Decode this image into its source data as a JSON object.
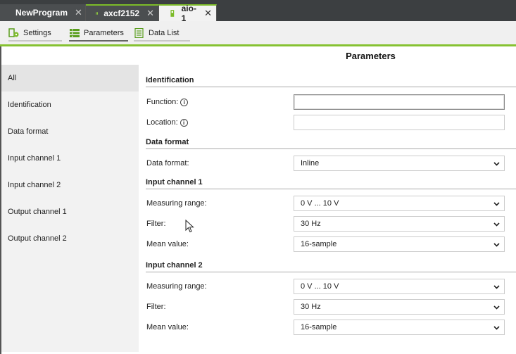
{
  "tabs": [
    {
      "label": "NewProgram",
      "icon": "program-icon",
      "close": "✕"
    },
    {
      "label": "axcf2152",
      "icon": "controller-icon",
      "close": "✕"
    },
    {
      "label": "aio-1",
      "icon": "module-icon",
      "close": "✕"
    }
  ],
  "toolbar": {
    "settings": "Settings",
    "parameters": "Parameters",
    "data_list": "Data List"
  },
  "page_title": "Parameters",
  "sidebar": {
    "items": [
      "All",
      "Identification",
      "Data format",
      "Input channel 1",
      "Input channel 2",
      "Output channel 1",
      "Output channel 2"
    ]
  },
  "identification": {
    "title": "Identification",
    "function_label": "Function:",
    "function_value": "",
    "location_label": "Location:",
    "location_value": ""
  },
  "data_format": {
    "title": "Data format",
    "label": "Data format:",
    "value": "Inline"
  },
  "input_channel_1": {
    "title": "Input channel 1",
    "measuring_range_label": "Measuring range:",
    "measuring_range_value": "0 V ... 10 V",
    "filter_label": "Filter:",
    "filter_value": "30 Hz",
    "mean_value_label": "Mean value:",
    "mean_value_value": "16-sample"
  },
  "input_channel_2": {
    "title": "Input channel 2",
    "measuring_range_label": "Measuring range:",
    "measuring_range_value": "0 V ... 10 V",
    "filter_label": "Filter:",
    "filter_value": "30 Hz",
    "mean_value_label": "Mean value:",
    "mean_value_value": "16-sample"
  },
  "colors": {
    "accent": "#7cbb28",
    "dark": "#3c3f41"
  }
}
